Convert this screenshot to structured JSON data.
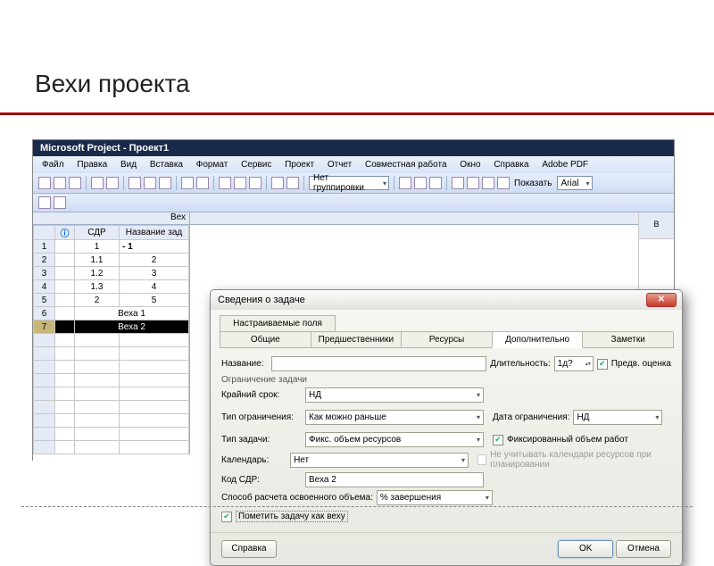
{
  "slide": {
    "title": "Вехи проекта"
  },
  "app": {
    "title": "Microsoft Project - Проект1",
    "menu": [
      "Файл",
      "Правка",
      "Вид",
      "Вставка",
      "Формат",
      "Сервис",
      "Проект",
      "Отчет",
      "Совместная работа",
      "Окно",
      "Справка",
      "Adobe PDF"
    ],
    "toolbar": {
      "group_combo": "Нет группировки",
      "show_label": "Показать",
      "font_combo": "Arial"
    },
    "split_label": "Вех",
    "columns": [
      "",
      "СДР",
      "Название зад"
    ],
    "rows": [
      {
        "n": "1",
        "info": "",
        "sdr": "1",
        "name": "- 1"
      },
      {
        "n": "2",
        "info": "",
        "sdr": "1.1",
        "name": "2"
      },
      {
        "n": "3",
        "info": "",
        "sdr": "1.2",
        "name": "3"
      },
      {
        "n": "4",
        "info": "",
        "sdr": "1.3",
        "name": "4"
      },
      {
        "n": "5",
        "info": "",
        "sdr": "2",
        "name": "5"
      },
      {
        "n": "6",
        "info": "",
        "sdr": "Веха 1",
        "name": ""
      },
      {
        "n": "7",
        "info": "",
        "sdr": "Веха 2",
        "name": ""
      }
    ],
    "far_col": "В"
  },
  "dialog": {
    "title": "Сведения о задаче",
    "tabs_top": [
      "Настраиваемые поля"
    ],
    "tabs": [
      "Общие",
      "Предшественники",
      "Ресурсы",
      "Дополнительно",
      "Заметки"
    ],
    "active_tab": "Дополнительно",
    "fields": {
      "name_label": "Название:",
      "name_value": "",
      "duration_label": "Длительность:",
      "duration_value": "1д?",
      "prelim_label": "Предв. оценка",
      "section_constraint": "Ограничение задачи",
      "deadline_label": "Крайний срок:",
      "deadline_value": "НД",
      "constraint_type_label": "Тип ограничения:",
      "constraint_type_value": "Как можно раньше",
      "constraint_date_label": "Дата ограничения:",
      "constraint_date_value": "НД",
      "task_type_label": "Тип задачи:",
      "task_type_value": "Фикс. объем ресурсов",
      "fixed_work_label": "Фиксированный объем работ",
      "calendar_label": "Календарь:",
      "calendar_value": "Нет",
      "ignore_rcal_label": "Не учитывать календари ресурсов при планировании",
      "wbs_label": "Код СДР:",
      "wbs_value": "Веха 2",
      "ev_label": "Способ расчета освоенного объема:",
      "ev_value": "% завершения",
      "milestone_label": "Пометить задачу как веху"
    },
    "buttons": {
      "help": "Справка",
      "ok": "OK",
      "cancel": "Отмена"
    }
  }
}
